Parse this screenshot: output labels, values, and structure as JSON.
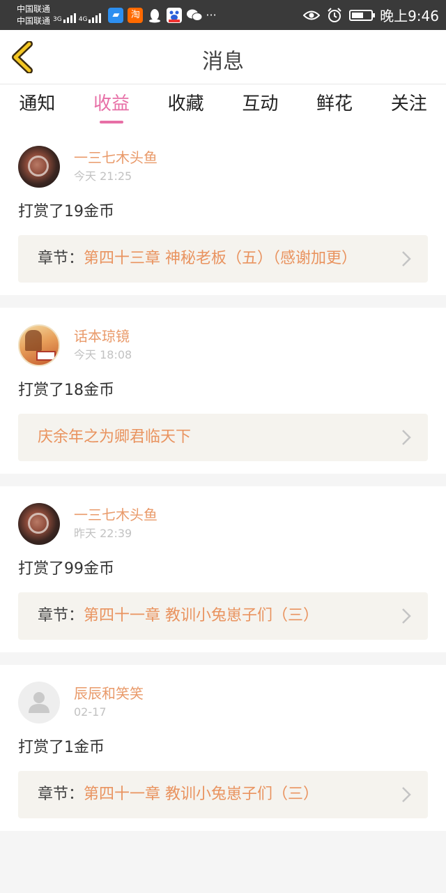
{
  "status_bar": {
    "carrier1": "中国联通",
    "carrier2": "中国联通",
    "net1": "3G",
    "net2": "4G",
    "taobao_glyph": "淘",
    "dots": "···",
    "time": "晚上9:46",
    "icons": [
      "wifi-hotspot-icon",
      "taobao-icon",
      "qq-icon",
      "baidu-icon",
      "wechat-icon",
      "eye-icon",
      "alarm-icon",
      "battery-icon"
    ]
  },
  "header": {
    "title": "消息"
  },
  "tabs": [
    {
      "label": "通知"
    },
    {
      "label": "收益",
      "active": true
    },
    {
      "label": "收藏"
    },
    {
      "label": "互动"
    },
    {
      "label": "鲜花"
    },
    {
      "label": "关注"
    }
  ],
  "items": [
    {
      "user": "一三七木头鱼",
      "time": "今天 21:25",
      "action": "打赏了19金币",
      "ref_label": "章节：",
      "ref_value": "第四十三章 神秘老板（五）（感谢加更）"
    },
    {
      "user": "话本琼镜",
      "time": "今天 18:08",
      "action": "打赏了18金币",
      "ref_label": "",
      "ref_value": "庆余年之为卿君临天下"
    },
    {
      "user": "一三七木头鱼",
      "time": "昨天 22:39",
      "action": "打赏了99金币",
      "ref_label": "章节：",
      "ref_value": "第四十一章 教训小兔崽子们（三）"
    },
    {
      "user": "辰辰和笑笑",
      "time": "02-17",
      "action": "打赏了1金币",
      "ref_label": "章节：",
      "ref_value": "第四十一章 教训小兔崽子们（三）"
    }
  ],
  "colors": {
    "accent": "#e76fa6",
    "username": "#e99a6a",
    "link": "#e9935f",
    "status_bar": "#3a3a3a"
  }
}
